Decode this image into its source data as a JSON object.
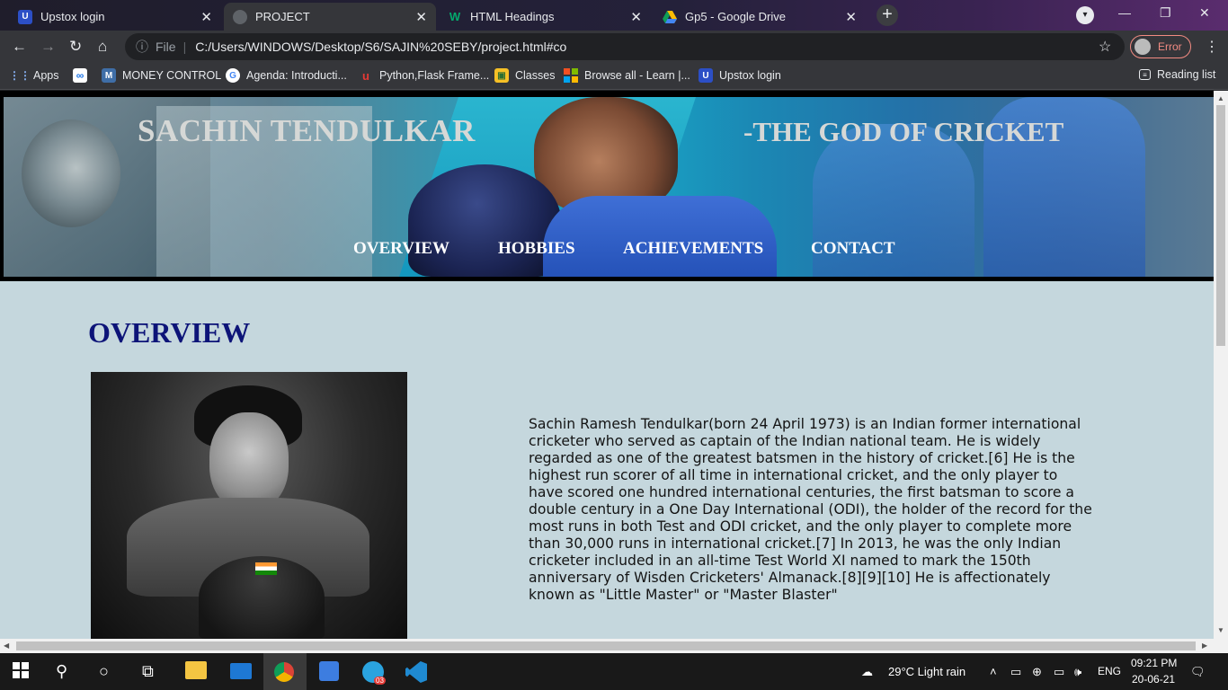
{
  "tabs": [
    {
      "title": "Upstox login",
      "active": false
    },
    {
      "title": "PROJECT",
      "active": true
    },
    {
      "title": "HTML Headings",
      "active": false
    },
    {
      "title": "Gp5 - Google Drive",
      "active": false
    }
  ],
  "tab_close_glyph": "✕",
  "toolbar": {
    "scheme_label": "File",
    "url": "C:/Users/WINDOWS/Desktop/S6/SAJIN%20SEBY/project.html#co",
    "profile_status": "Error"
  },
  "bookmarks": [
    "Apps",
    "",
    "MONEY CONTROL",
    "Agenda: Introducti...",
    "Python,Flask Frame...",
    "Classes",
    "Browse all - Learn |...",
    "Upstox login"
  ],
  "reading_list": "Reading list",
  "page": {
    "banner_title": "SACHIN TENDULKAR",
    "banner_tagline": "-THE GOD OF CRICKET",
    "nav": [
      "OVERVIEW",
      "HOBBIES",
      "ACHIEVEMENTS",
      "CONTACT"
    ],
    "section_title": "OVERVIEW",
    "overview_text": "Sachin Ramesh Tendulkar(born 24 April 1973) is an Indian former international cricketer who served as captain of the Indian national team. He is widely regarded as one of the greatest batsmen in the history of cricket.[6] He is the highest run scorer of all time in international cricket, and the only player to have scored one hundred international centuries, the first batsman to score a double century in a One Day International (ODI), the holder of the record for the most runs in both Test and ODI cricket, and the only player to complete more than 30,000 runs in international cricket.[7] In 2013, he was the only Indian cricketer included in an all-time Test World XI named to mark the 150th anniversary of Wisden Cricketers' Almanack.[8][9][10] He is affectionately known as \"Little Master\" or \"Master Blaster\""
  },
  "taskbar": {
    "weather": "29°C  Light rain",
    "language": "ENG",
    "time": "09:21 PM",
    "date": "20-06-21",
    "telegram_badge": "03"
  },
  "icons": {
    "tab_favicons": [
      "upstox-icon",
      "globe-icon",
      "w3schools-icon",
      "google-drive-icon"
    ],
    "nav_buttons": [
      "back-icon",
      "forward-icon",
      "reload-icon",
      "home-icon"
    ]
  },
  "colors": {
    "page_background": "#c5d7dd",
    "section_title": "#0d1478",
    "browser_chrome": "#35363a",
    "profile_error": "#f28b82"
  }
}
